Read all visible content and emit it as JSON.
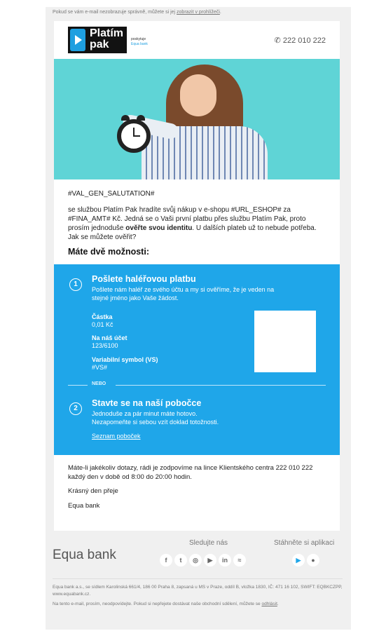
{
  "preheader": {
    "text": "Pokud se vám e-mail nezobrazuje správně, můžete si jej ",
    "link": "zobrazit v prohlížeči",
    "end": "."
  },
  "header": {
    "logo_line1": "Platím",
    "logo_line2": "pak",
    "provider_1": "poskytuje",
    "provider_2": "Equa bank",
    "phone_icon": "phone-icon",
    "phone": "222 010 222"
  },
  "hero": {
    "description": "woman holding alarm clock"
  },
  "body": {
    "salutation": "#VAL_GEN_SALUTATION#",
    "p1_before": "se službou Platím Pak hradíte svůj nákup v e-shopu #URL_ESHOP# za #FINA_AMT# Kč. Jedná se o Vaši první platbu přes službu Platím Pak, proto prosím jednoduše ",
    "p1_bold": "ověřte svou identitu",
    "p1_after": ". U dalších plateb už to nebude potřeba. Jak se můžete ověřit?",
    "options_heading": "Máte dvě možnosti:"
  },
  "option1": {
    "number": "1",
    "title": "Pošlete haléřovou platbu",
    "desc": "Pošlete nám haléř ze svého účtu a my si ověříme, že je veden na stejné jméno jako Vaše žádost.",
    "amount_label": "Částka",
    "amount_value": "0,01 Kč",
    "account_label": "Na náš účet",
    "account_value": "123/6100",
    "vs_label": "Variabilní symbol (VS)",
    "vs_value": "#VS#"
  },
  "separator": "NEBO",
  "option2": {
    "number": "2",
    "title": "Stavte se na naší pobočce",
    "desc1": "Jednoduše za pár minut máte hotovo.",
    "desc2": "Nezapomeňte si sebou vzít doklad totožnosti.",
    "link": "Seznam poboček"
  },
  "closing": {
    "contact": "Máte-li jakékoliv dotazy, rádi je zodpovíme na lince Klientského centra 222 010 222 každý den v době od 8:00 do 20:00 hodin.",
    "greeting": "Krásný den přeje",
    "signature": "Equa bank"
  },
  "footer": {
    "logo": "Equa bank",
    "follow": "Sledujte nás",
    "apps": "Stáhněte si aplikaci",
    "socials": [
      {
        "glyph": "f",
        "icon": "facebook-icon"
      },
      {
        "glyph": "t",
        "icon": "twitter-icon"
      },
      {
        "glyph": "◎",
        "icon": "instagram-icon"
      },
      {
        "glyph": "▶",
        "icon": "youtube-icon"
      },
      {
        "glyph": "in",
        "icon": "linkedin-icon"
      },
      {
        "glyph": "≈",
        "icon": "rss-icon"
      }
    ],
    "app_icons": [
      {
        "glyph": "▶",
        "icon": "google-play-icon"
      },
      {
        "glyph": "●",
        "icon": "apple-icon"
      }
    ]
  },
  "legal": {
    "line1": "Equa bank a.s., se sídlem Karolinská 661/4, 186 00 Praha 8, zapsaná u MS v Praze, oddíl B, vložka 1830, IČ: 471 16 102, SWIFT: EQBKCZPP, www.equabank.cz.",
    "line2_before": "Na tento e-mail, prosím, neodpovídejte. Pokud si nepřejete dostávat naše obchodní sdělení, můžete se ",
    "line2_link": "odhlásit",
    "line2_after": "."
  },
  "colors": {
    "brand_blue": "#1fa6e9",
    "logo_black": "#121212",
    "hero_bg": "#5fd4d6"
  }
}
